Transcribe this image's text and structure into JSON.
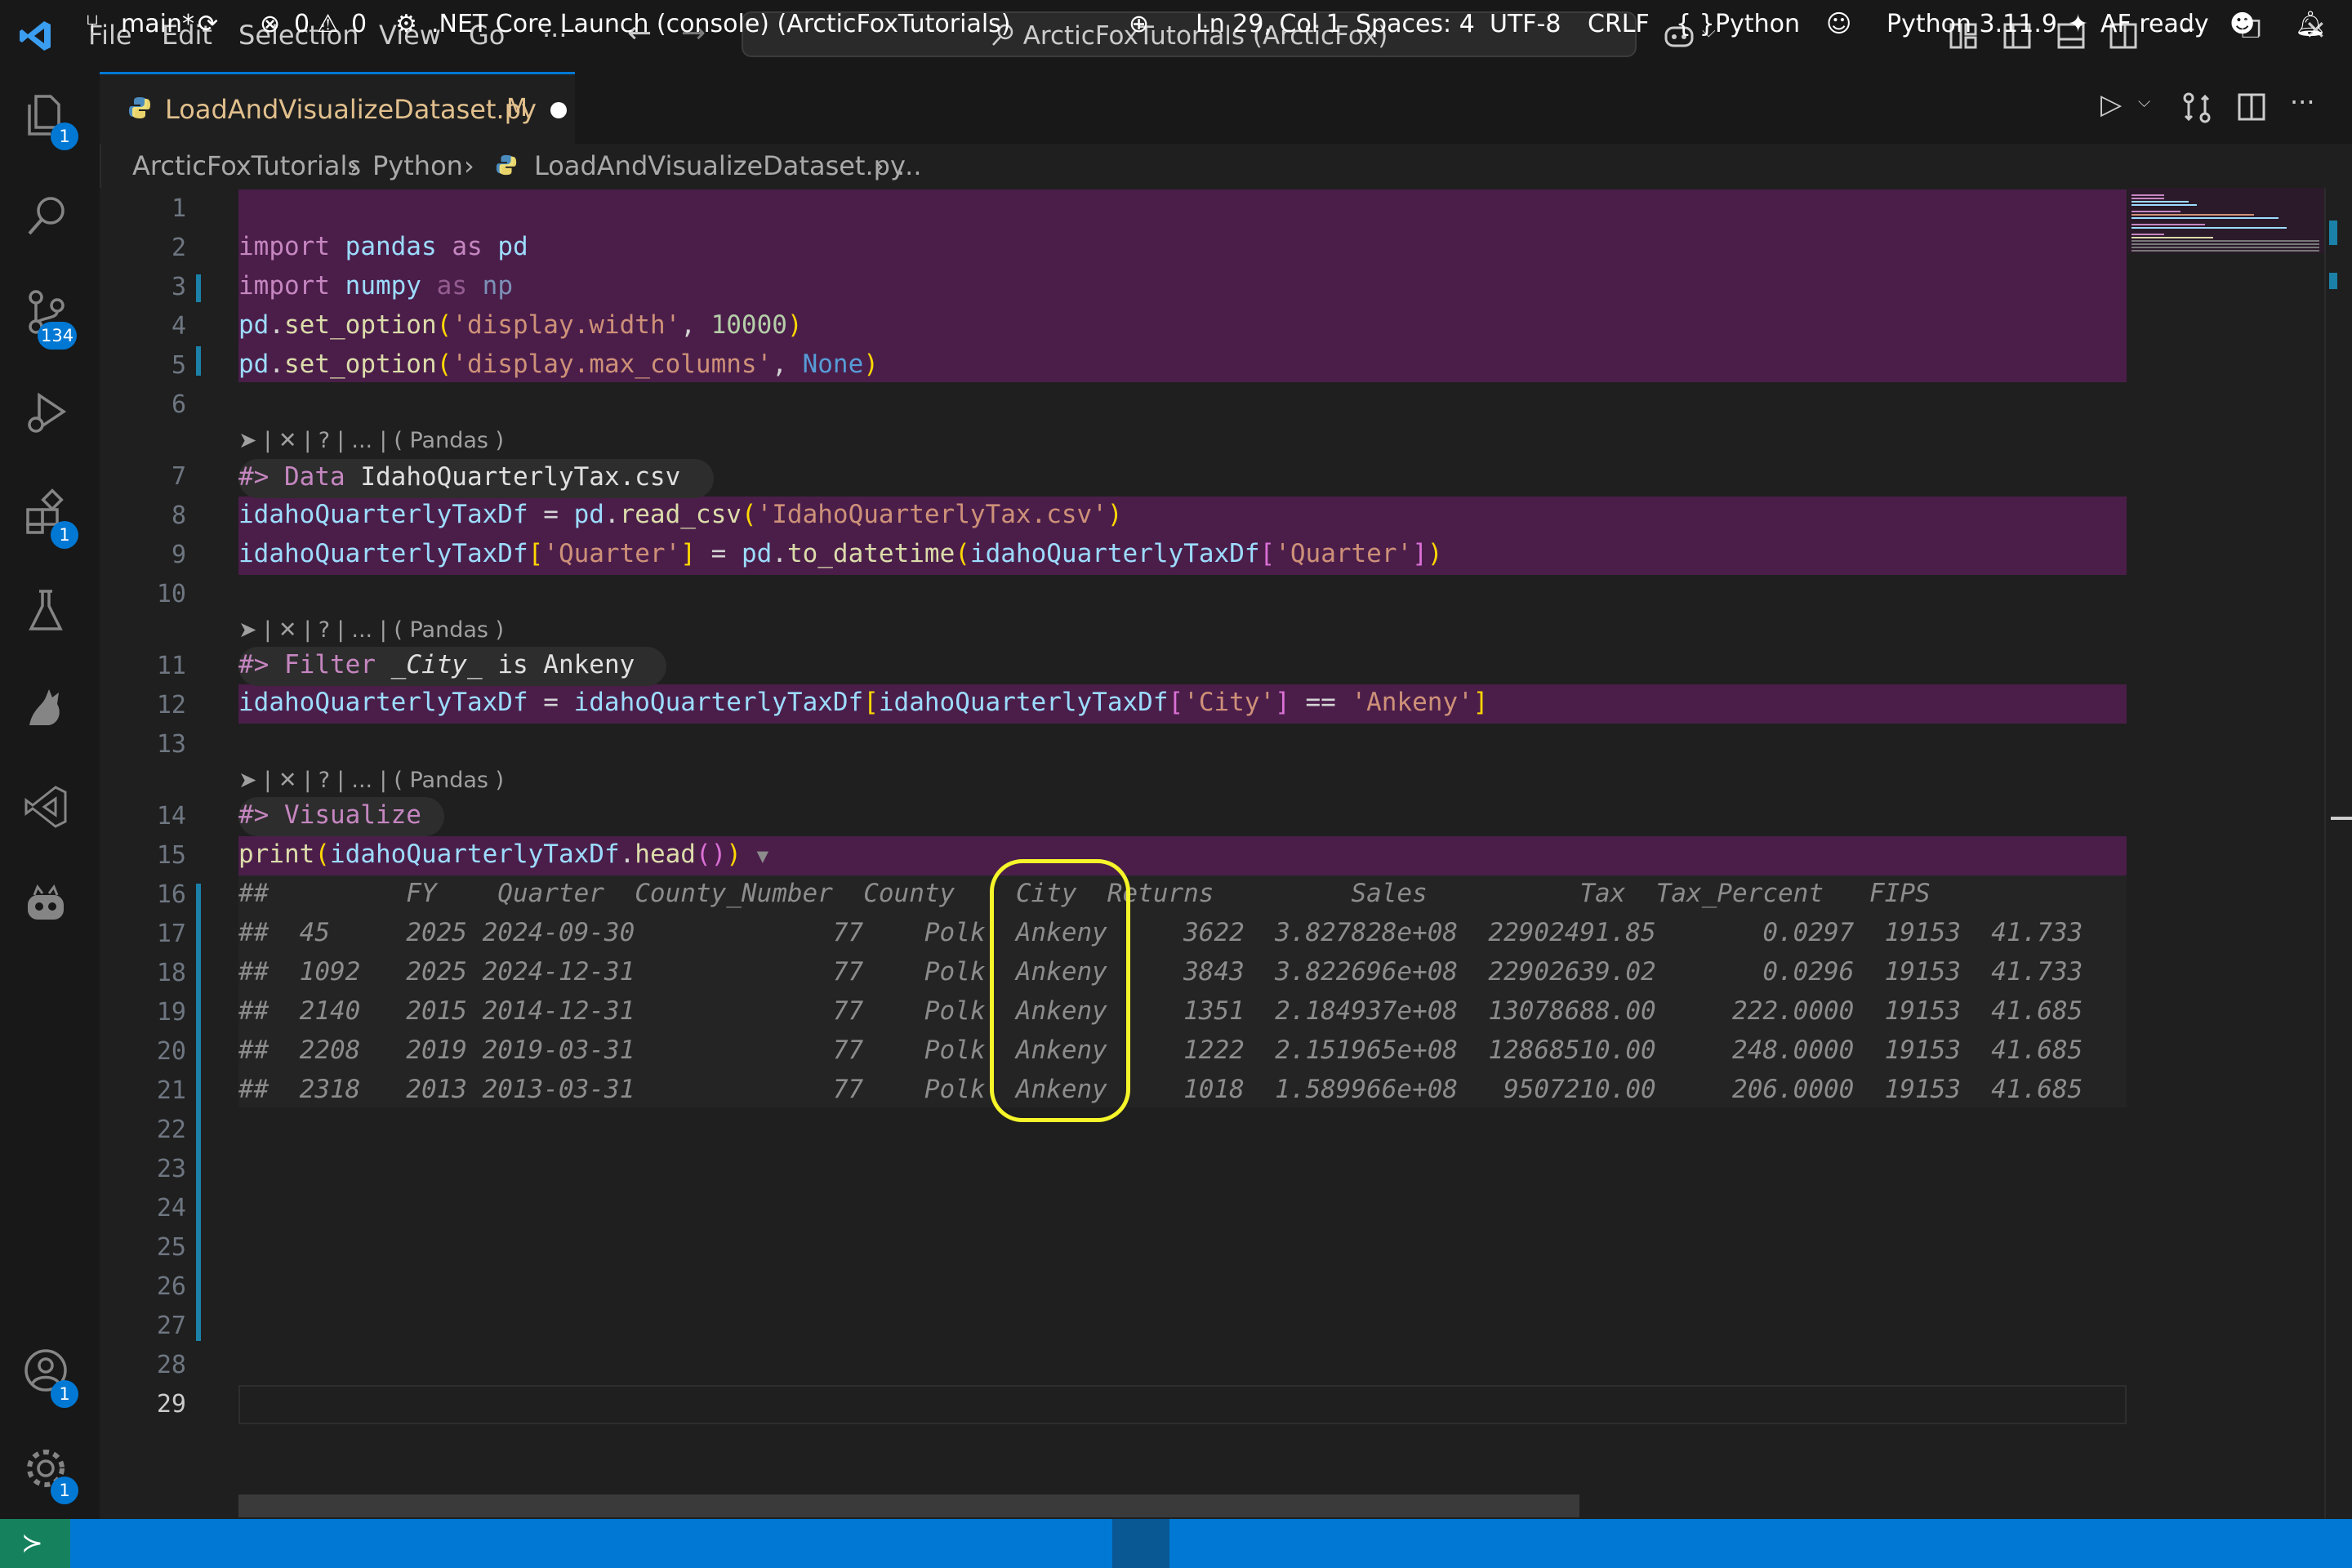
{
  "titlebar": {
    "menu": [
      "File",
      "Edit",
      "Selection",
      "View",
      "Go"
    ],
    "more": "···",
    "search_text": "ArcticFoxTutorials (ArcticFox)"
  },
  "activitybar": {
    "explorer_badge": "1",
    "scm_badge": "134",
    "extensions_badge": "1",
    "accounts_badge": "1",
    "settings_badge": "1"
  },
  "tab": {
    "filename": "LoadAndVisualizeDataset.py",
    "modified": "M"
  },
  "breadcrumb": {
    "root": "ArcticFoxTutorials",
    "folder": "Python",
    "file": "LoadAndVisualizeDataset.py",
    "more": "..."
  },
  "editor": {
    "line_numbers": [
      "1",
      "2",
      "3",
      "4",
      "5",
      "6",
      "7",
      "8",
      "9",
      "10",
      "11",
      "12",
      "13",
      "14",
      "15",
      "16",
      "17",
      "18",
      "19",
      "20",
      "21",
      "22",
      "23",
      "24",
      "25",
      "26",
      "27",
      "28",
      "29"
    ],
    "codelens": "➤ | ✕ | ? | ... | ( Pandas )",
    "lines": {
      "l2": [
        "import",
        "pandas",
        "as",
        "pd"
      ],
      "l3": [
        "import",
        "numpy",
        "as",
        "np"
      ],
      "l4": [
        "pd",
        ".",
        "set_option",
        "(",
        "'display.width'",
        ", ",
        "10000",
        ")"
      ],
      "l5": [
        "pd",
        ".",
        "set_option",
        "(",
        "'display.max_columns'",
        ", ",
        "None",
        ")"
      ],
      "l7": [
        "#>",
        "Data",
        "IdahoQuarterlyTax.csv"
      ],
      "l8": [
        "idahoQuarterlyTaxDf",
        " = ",
        "pd",
        ".",
        "read_csv",
        "(",
        "'IdahoQuarterlyTax.csv'",
        ")"
      ],
      "l9": [
        "idahoQuarterlyTaxDf",
        "[",
        "'Quarter'",
        "]",
        " = ",
        "pd",
        ".",
        "to_datetime",
        "(",
        "idahoQuarterlyTaxDf",
        "[",
        "'Quarter'",
        "]",
        ")"
      ],
      "l11": [
        "#>",
        "Filter",
        "_City_",
        "is Ankeny"
      ],
      "l12": [
        "idahoQuarterlyTaxDf",
        " = ",
        "idahoQuarterlyTaxDf",
        "[",
        "idahoQuarterlyTaxDf",
        "[",
        "'City'",
        "]",
        " == ",
        "'Ankeny'",
        "]"
      ],
      "l14": [
        "#>",
        "Visualize"
      ],
      "l15": [
        "print",
        "(",
        "idahoQuarterlyTaxDf",
        ".",
        "head",
        "()",
        ")",
        "▼"
      ]
    },
    "output_header": "##         FY    Quarter  County_Number  County    City  Returns         Sales          Tax  Tax_Percent   FIPS      ",
    "output_rows": [
      "##  45     2025 2024-09-30             77    Polk  Ankeny     3622  3.827828e+08  22902491.85       0.0297  19153  41.733",
      "##  1092   2025 2024-12-31             77    Polk  Ankeny     3843  3.822696e+08  22902639.02       0.0296  19153  41.733",
      "##  2140   2015 2014-12-31             77    Polk  Ankeny     1351  2.184937e+08  13078688.00     222.0000  19153  41.685",
      "##  2208   2019 2019-03-31             77    Polk  Ankeny     1222  2.151965e+08  12868510.00     248.0000  19153  41.685",
      "##  2318   2013 2013-03-31             77    Polk  Ankeny     1018  1.589966e+08   9507210.00     206.0000  19153  41.685"
    ]
  },
  "statusbar": {
    "branch": "main*",
    "errors": "0",
    "warnings": "0",
    "launch": ".NET Core Launch (console) (ArcticFoxTutorials)",
    "position": "Ln 29, Col 1",
    "spaces": "Spaces: 4",
    "encoding": "UTF-8",
    "eol": "CRLF",
    "language": "Python",
    "interpreter": "Python 3.11.9",
    "af": "AF ready"
  },
  "colors": {
    "accent": "#0078d4",
    "highlight": "#4b1e4a",
    "annotation": "#f5f52a",
    "remote": "#16825d"
  }
}
